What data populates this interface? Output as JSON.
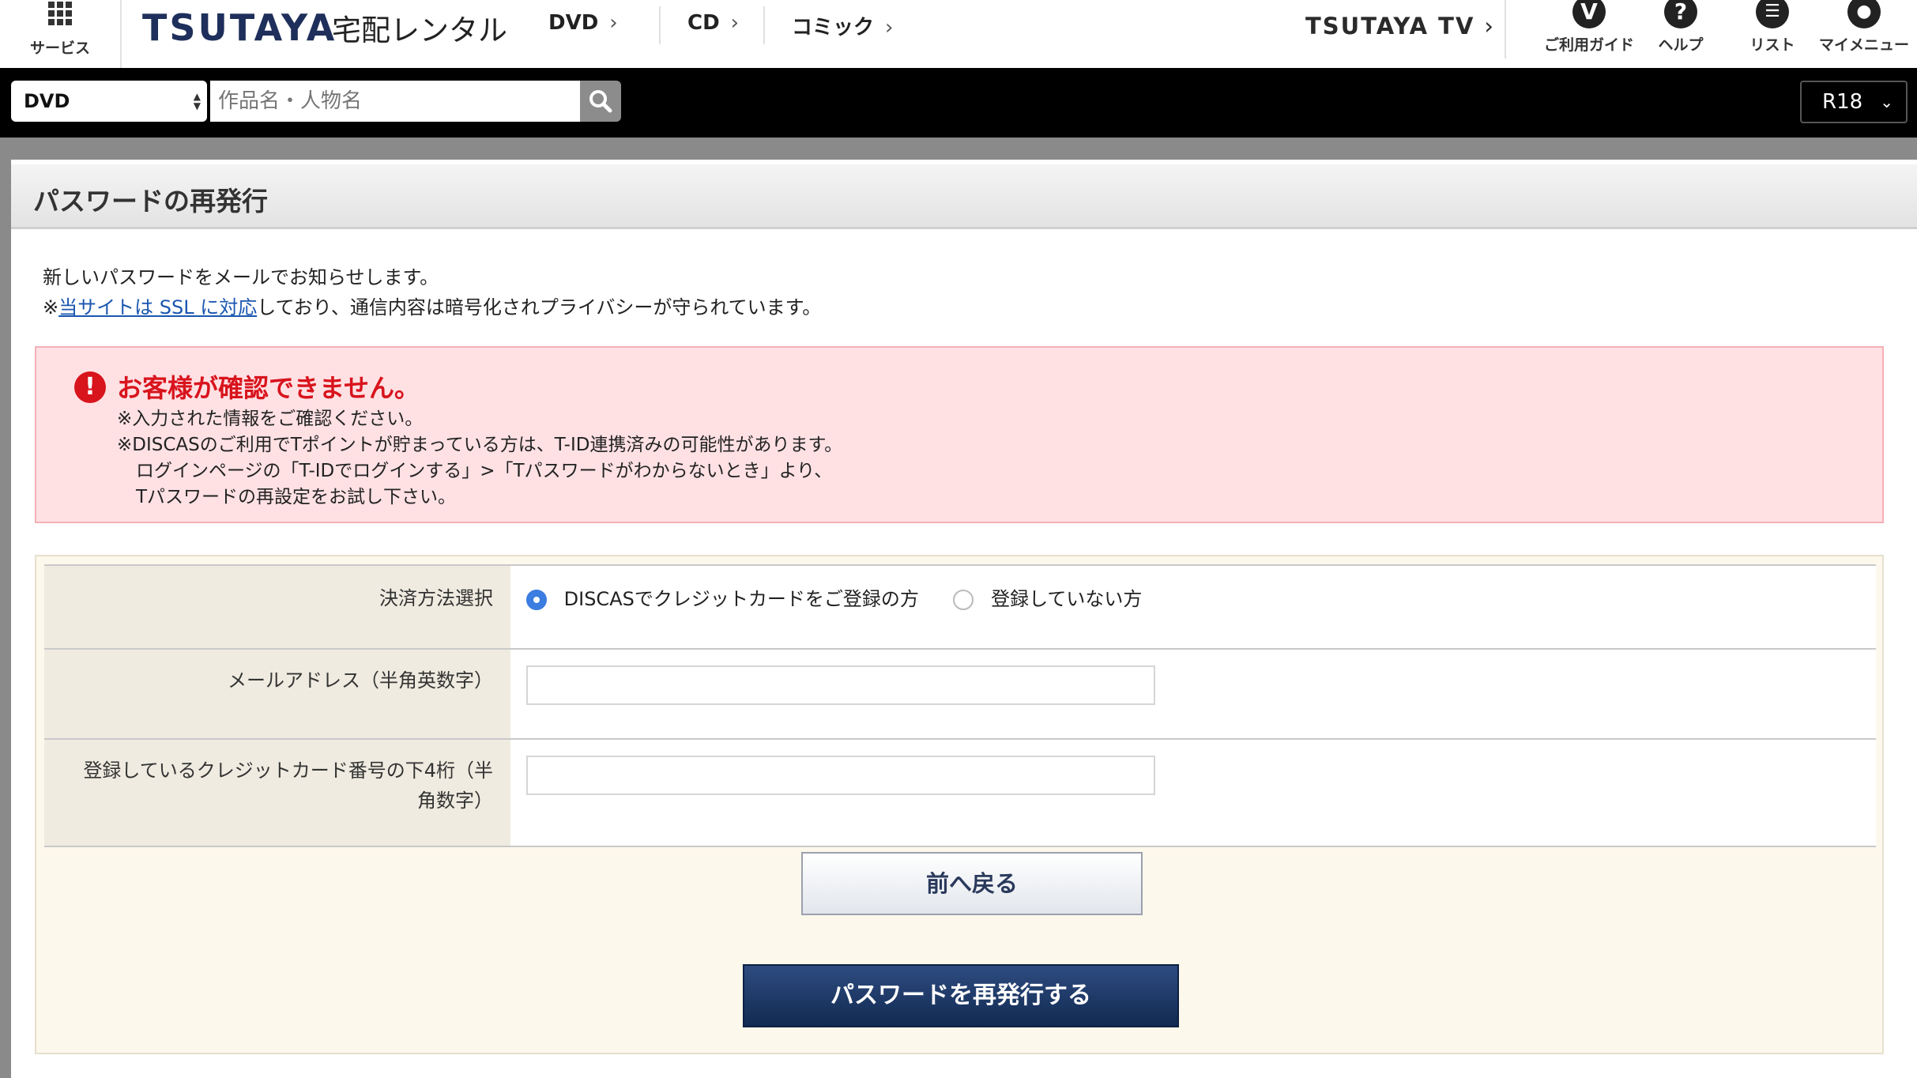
{
  "header": {
    "services_label": "サービス",
    "logo": "TSUTAYA",
    "logo_sub": "宅配レンタル",
    "nav": [
      "DVD",
      "CD",
      "コミック"
    ],
    "tv_link": "TSUTAYA TV",
    "icons": [
      {
        "icon": "shield-icon",
        "label": "ご利用ガイド"
      },
      {
        "icon": "help-icon",
        "label": "ヘルプ"
      },
      {
        "icon": "list-icon",
        "label": "リスト"
      },
      {
        "icon": "user-icon",
        "label": "マイメニュー"
      }
    ]
  },
  "search": {
    "category": "DVD",
    "placeholder": "作品名・人物名",
    "rating": "R18"
  },
  "page": {
    "title": "パスワードの再発行",
    "intro_line1": "新しいパスワードをメールでお知らせします。",
    "intro_prefix": "※",
    "intro_link": "当サイトは SSL に対応",
    "intro_suffix": "しており、通信内容は暗号化されプライバシーが守られています。"
  },
  "error": {
    "title": "お客様が確認できません。",
    "lines": [
      "※入力された情報をご確認ください。",
      "※DISCASのご利用でTポイントが貯まっている方は、T-ID連携済みの可能性があります。",
      "ログインページの「T-IDでログインする」>「Tパスワードがわからないとき」より、",
      "Tパスワードの再設定をお試し下さい。"
    ]
  },
  "form": {
    "payment_label": "決済方法選択",
    "payment_options": [
      "DISCASでクレジットカードをご登録の方",
      "登録していない方"
    ],
    "payment_selected": 0,
    "email_label": "メールアドレス（半角英数字）",
    "email_value": "",
    "card_label": "登録しているクレジットカード番号の下4桁（半角数字）",
    "card_value": ""
  },
  "buttons": {
    "back": "前へ戻る",
    "submit": "パスワードを再発行する"
  },
  "colors": {
    "brand_navy": "#1f2f5b",
    "error_red": "#d8141d",
    "error_bg": "#ffe1e4",
    "radio_blue": "#3b7de0"
  }
}
